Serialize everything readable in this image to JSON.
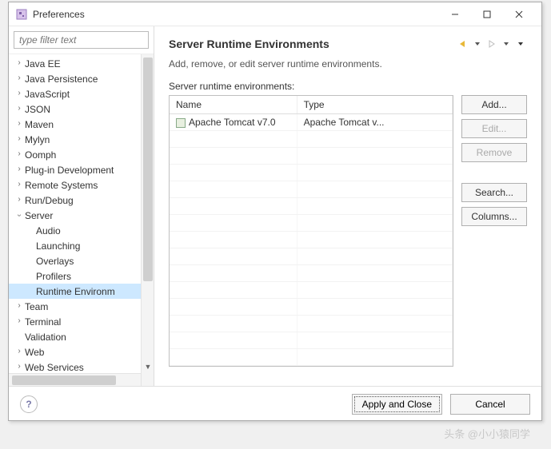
{
  "window": {
    "title": "Preferences",
    "filter_placeholder": "type filter text"
  },
  "tree": {
    "items": [
      {
        "label": "Java EE",
        "expandable": true
      },
      {
        "label": "Java Persistence",
        "expandable": true
      },
      {
        "label": "JavaScript",
        "expandable": true
      },
      {
        "label": "JSON",
        "expandable": true
      },
      {
        "label": "Maven",
        "expandable": true
      },
      {
        "label": "Mylyn",
        "expandable": true
      },
      {
        "label": "Oomph",
        "expandable": true
      },
      {
        "label": "Plug-in Development",
        "expandable": true
      },
      {
        "label": "Remote Systems",
        "expandable": true
      },
      {
        "label": "Run/Debug",
        "expandable": true
      },
      {
        "label": "Server",
        "expandable": true,
        "expanded": true,
        "children": [
          {
            "label": "Audio"
          },
          {
            "label": "Launching"
          },
          {
            "label": "Overlays"
          },
          {
            "label": "Profilers"
          },
          {
            "label": "Runtime Environm",
            "selected": true
          }
        ]
      },
      {
        "label": "Team",
        "expandable": true
      },
      {
        "label": "Terminal",
        "expandable": true
      },
      {
        "label": "Validation",
        "expandable": false
      },
      {
        "label": "Web",
        "expandable": true
      },
      {
        "label": "Web Services",
        "expandable": true
      }
    ]
  },
  "main": {
    "title": "Server Runtime Environments",
    "description": "Add, remove, or edit server runtime environments.",
    "section_label": "Server runtime environments:",
    "columns": {
      "name": "Name",
      "type": "Type"
    },
    "rows": [
      {
        "name": "Apache Tomcat v7.0",
        "type": "Apache Tomcat v..."
      }
    ],
    "actions": {
      "add": "Add...",
      "edit": "Edit...",
      "remove": "Remove",
      "search": "Search...",
      "columns": "Columns..."
    }
  },
  "footer": {
    "apply": "Apply and Close",
    "cancel": "Cancel"
  },
  "watermark": "头条 @小小猿同学"
}
